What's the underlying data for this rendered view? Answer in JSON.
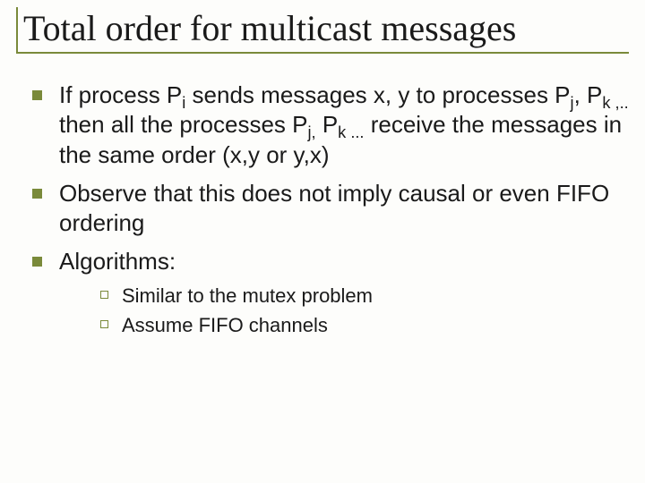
{
  "title": "Total order for multicast messages",
  "bullets": [
    {
      "parts": [
        {
          "t": "If process P"
        },
        {
          "t": "i",
          "sub": true
        },
        {
          "t": " sends messages x, y to processes P"
        },
        {
          "t": "j",
          "sub": true
        },
        {
          "t": ", P"
        },
        {
          "t": "k ,..",
          "sub": true
        },
        {
          "t": " then all the processes P"
        },
        {
          "t": "j,",
          "sub": true
        },
        {
          "t": " P"
        },
        {
          "t": "k ...",
          "sub": true
        },
        {
          "t": " receive the messages in the same order (x,y or y,x)"
        }
      ]
    },
    {
      "parts": [
        {
          "t": "Observe that this does not imply causal or even FIFO ordering"
        }
      ]
    },
    {
      "parts": [
        {
          "t": "Algorithms:"
        }
      ],
      "children": [
        {
          "parts": [
            {
              "t": "Similar to the mutex problem"
            }
          ]
        },
        {
          "parts": [
            {
              "t": "Assume FIFO channels"
            }
          ]
        }
      ]
    }
  ]
}
